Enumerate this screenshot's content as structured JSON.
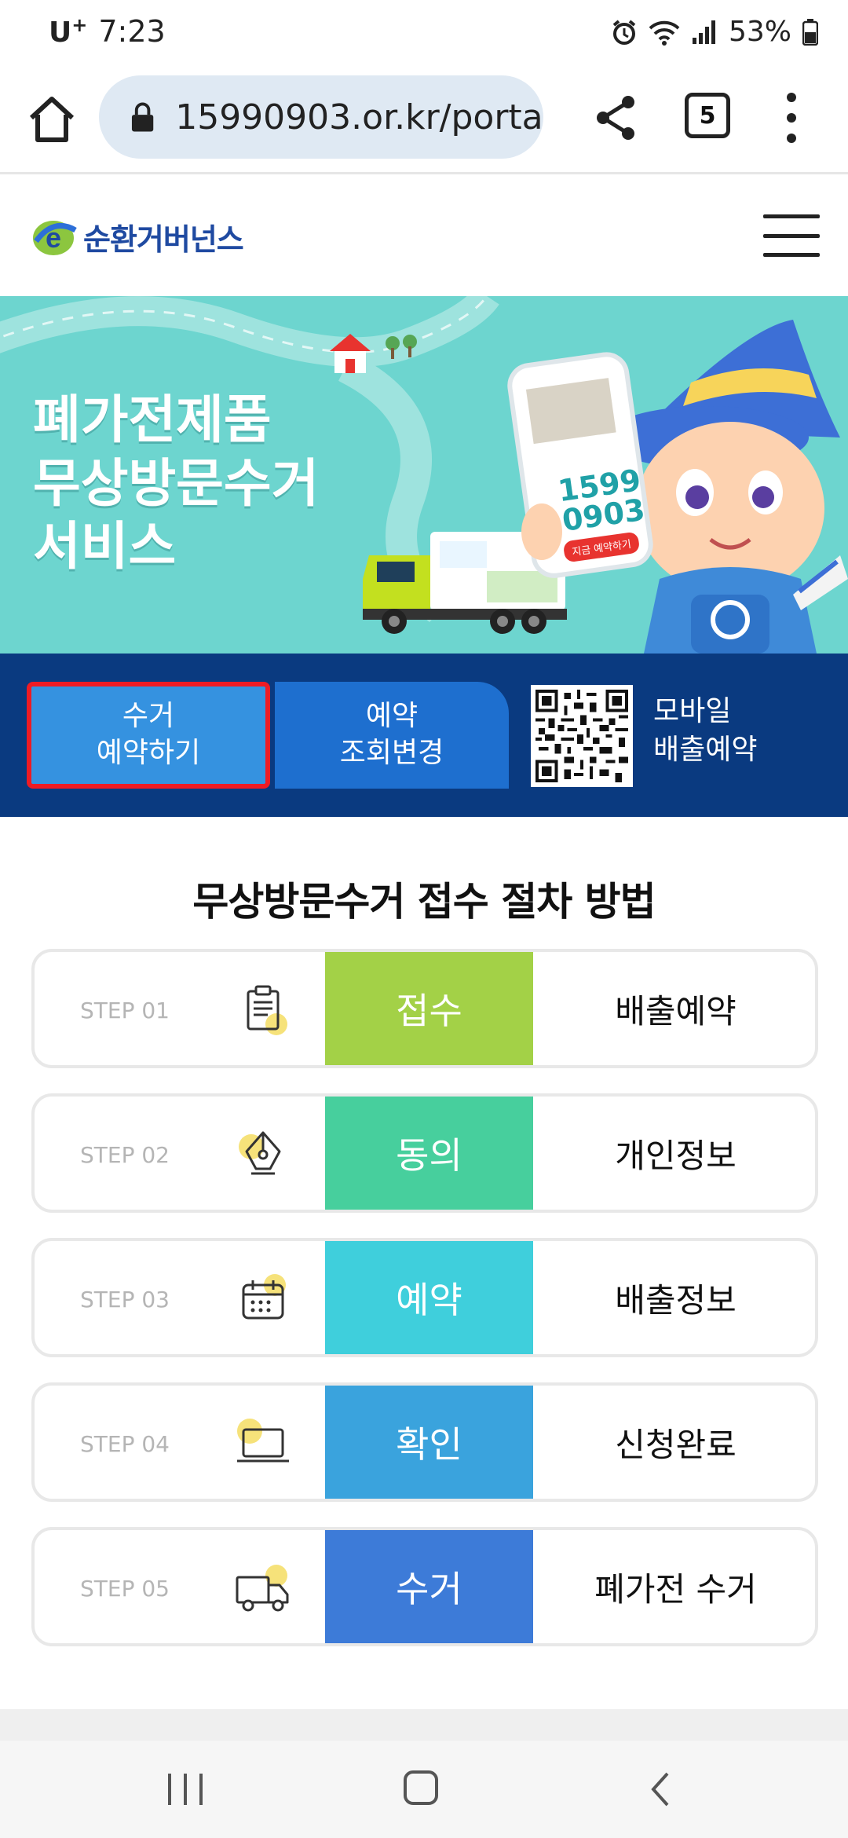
{
  "status_bar": {
    "carrier": "U",
    "carrier_sup": "+",
    "time": "7:23",
    "battery": "53%"
  },
  "browser": {
    "url": "15990903.or.kr/portal",
    "tab_count": "5"
  },
  "site": {
    "logo_text": "순환거버넌스"
  },
  "banner": {
    "title_line1": "폐가전제품",
    "title_line2": "무상방문수거",
    "title_line3": "서비스",
    "phone_number_line1": "1599",
    "phone_number_line2": "0903",
    "phone_button": "지금 예약하기"
  },
  "actions": {
    "reserve_line1": "수거",
    "reserve_line2": "예약하기",
    "lookup_line1": "예약",
    "lookup_line2": "조회변경",
    "mobile_line1": "모바일",
    "mobile_line2": "배출예약"
  },
  "steps_title": "무상방문수거 접수 절차 방법",
  "steps": [
    {
      "no": "STEP 01",
      "verb": "접수",
      "desc": "배출예약",
      "color": "#a3d147",
      "icon": "clipboard-icon"
    },
    {
      "no": "STEP 02",
      "verb": "동의",
      "desc": "개인정보",
      "color": "#47cf9d",
      "icon": "pen-nib-icon"
    },
    {
      "no": "STEP 03",
      "verb": "예약",
      "desc": "배출정보",
      "color": "#3fcfdc",
      "icon": "calendar-icon"
    },
    {
      "no": "STEP 04",
      "verb": "확인",
      "desc": "신청완료",
      "color": "#3aa3dd",
      "icon": "laptop-icon"
    },
    {
      "no": "STEP 05",
      "verb": "수거",
      "desc": "폐가전 수거",
      "color": "#3d7bd8",
      "icon": "truck-icon"
    }
  ],
  "colors": {
    "action_bar_bg": "#0a3a80",
    "reserve_btn": "#3592e0",
    "lookup_btn": "#1e6fcf",
    "highlight_border": "#ee1b24",
    "banner_bg": "#6dd5cf"
  }
}
